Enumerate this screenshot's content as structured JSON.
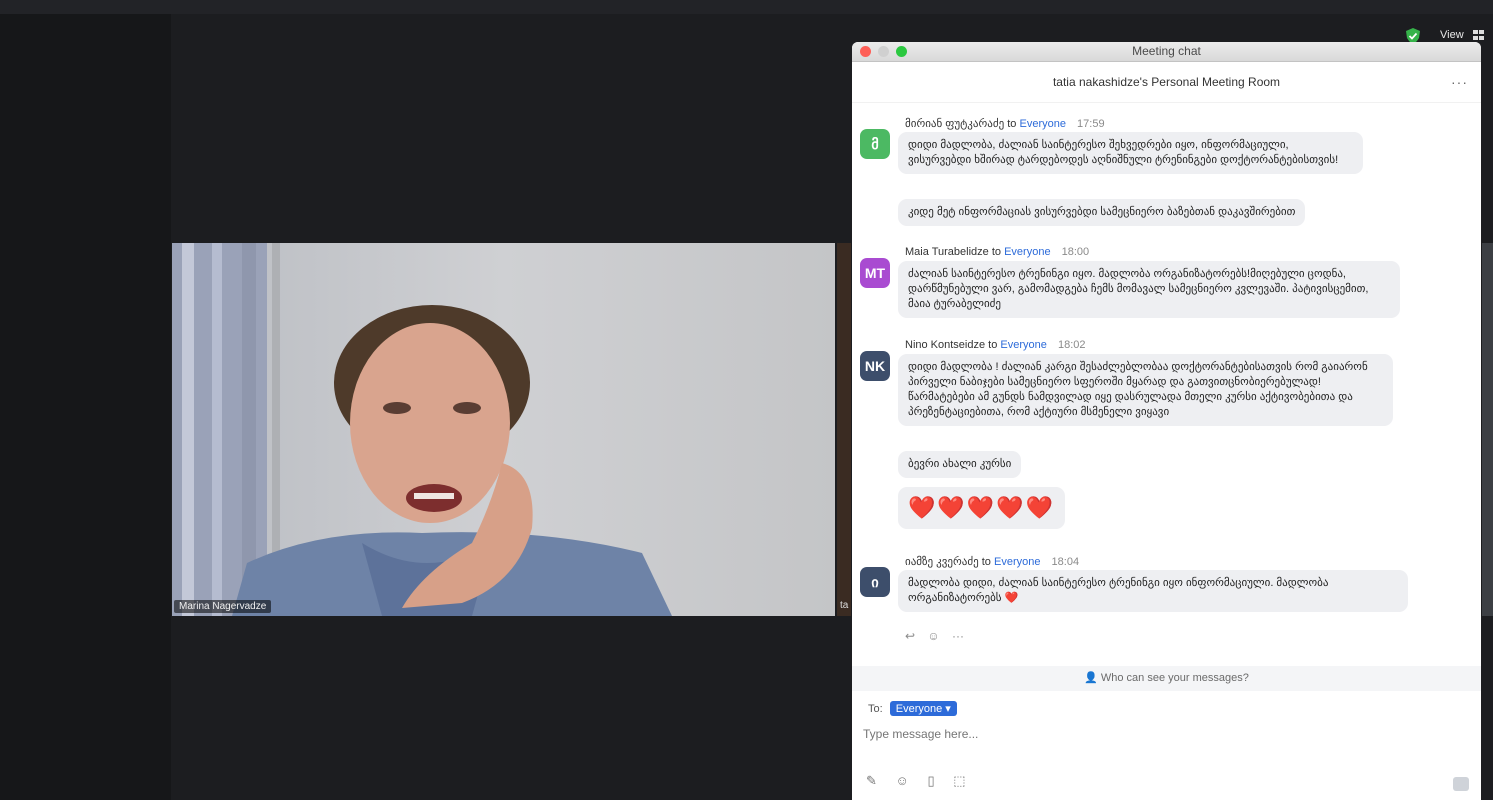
{
  "toolbar_top": {
    "view_label": "View"
  },
  "video": {
    "participant_name": "Marina Nagervadze",
    "side_tag": "ta"
  },
  "chat": {
    "window_title": "Meeting chat",
    "room_title": "tatia nakashidze's Personal Meeting Room",
    "more_label": "···",
    "messages": [
      {
        "avatar": "მ",
        "avatar_color": "#4cb963",
        "sender": "მირიან ფუტკარაძე",
        "to": "to",
        "recipient": "Everyone",
        "time": "17:59",
        "texts": [
          "დიდი მადლობა, ძალიან საინტერესო შეხვედრები იყო, ინფორმაციული, ვისურვებდი ხშირად ტარდებოდეს აღნიშნული ტრენინგები დოქტორანტებისთვის!",
          "კიდე მეტ ინფორმაციას ვისურვებდი სამეცნიერო ბაზებთან დაკავშირებით"
        ]
      },
      {
        "avatar": "MT",
        "avatar_color": "#a94bd1",
        "sender": "Maia Turabelidze",
        "to": "to",
        "recipient": "Everyone",
        "time": "18:00",
        "texts": [
          "ძალიან საინტერესო ტრენინგი იყო. მადლობა ორგანიზატორებს!მიღებული ცოდნა, დარწმუნებული ვარ, გამომადგება ჩემს მომავალ სამეცნიერო კვლევაში. პატივისცემით, მაია ტურაბელიძე"
        ]
      },
      {
        "avatar": "NK",
        "avatar_color": "#3d4e6b",
        "sender": "Nino Kontseidze",
        "to": "to",
        "recipient": "Everyone",
        "time": "18:02",
        "texts": [
          "დიდი მადლობა ! ძალიან კარგი შესაძლებლობაა დოქტორანტებისათვის რომ გაიარონ პირველი ნაბიჯები სამეცნიერო სფეროში მყარად და გათვითცნობიერებულად! წარმატებები ამ გუნდს ნამდვილად იყე დასრულადა მთელი კურსი აქტივობებითა და პრეზენტაციებითა, რომ აქტიური მსმენელი ვიყავი",
          "ბევრი ახალი კურსი",
          "❤️❤️❤️❤️❤️"
        ]
      },
      {
        "avatar": "ი",
        "avatar_color": "#3d4e6b",
        "sender": "იამზე კვერაძე",
        "to": "to",
        "recipient": "Everyone",
        "time": "18:04",
        "texts": [
          "მადლობა დიდი, ძალიან საინტერესო ტრენინგი იყო ინფორმაციული. მადლობა ორგანიზატორებს ❤️"
        ]
      }
    ],
    "visibility_prompt": "Who can see your messages?",
    "to_label": "To:",
    "recipient_select": "Everyone ▾",
    "input_placeholder": "Type message here..."
  },
  "colors": {
    "accent": "#2d6bd9",
    "bubble": "#eeeff2",
    "heart": "#e02424"
  },
  "icons": [
    "shield-check-icon",
    "grid-view-icon",
    "reply-icon",
    "emoji-reaction-icon",
    "more-icon",
    "screenshot-icon",
    "emoji-icon",
    "file-icon",
    "screen-capture-icon",
    "send-icon",
    "people-icon"
  ]
}
